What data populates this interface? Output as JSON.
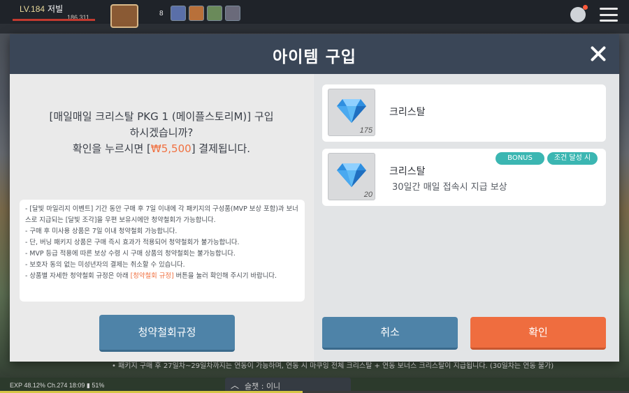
{
  "hud": {
    "level": "LV.184",
    "player_name": "저빌",
    "hp_text": "186,311",
    "quick_count": "8",
    "status": "EXP  48.12%  Ch.274  18:09",
    "battery": "51%",
    "chat_label": "슬챗 : 이니",
    "notice": "• 패키지 구매 후 27일차~29일차까지는 연동이 가능하며, 연동 시 마쿠잉 전체 크리스탈 + 연동 보너스 크리스탈이 지급됩니다. (30일차는 연동 불가)"
  },
  "modal": {
    "title": "아이템 구입",
    "confirm_line1": "[매일매일 크리스탈 PKG 1 (메이플스토리M)] 구입",
    "confirm_line2": "하시겠습니까?",
    "confirm_line3_before": "확인을 누르시면 [",
    "price": "₩5,500",
    "confirm_line3_after": "] 결제됩니다.",
    "terms": {
      "line1": "- [달빛 마일리지 이벤트] 기간 동안 구매 후 7일 이내에 각 패키지의 구성품(MVP 보상 포함)과 보너스로 지급되는 [달빛 조각]을 우편 보유시에만 청약철회가 가능합니다.",
      "line2": "- 구매 후 미사용 상품은 7일 이내 청약철회 가능합니다.",
      "line3": "- 단, 버닝 패키지 상품은 구매 즉시 효과가 적용되어 청약철회가 불가능합니다.",
      "line4": "- MVP 등급 적용에 따른 보상 수령 시 구매 상품의 청약철회는 불가능합니다.",
      "line5": "- 보호자 동의 없는 미성년자의 결제는 취소할 수 있습니다.",
      "line6_before": "- 상품별 자세한 청약철회 규정은 아래 ",
      "line6_link": "[청약철회 규정]",
      "line6_after": " 버튼을 눌러 확인해 주시기 바랍니다."
    },
    "buttons": {
      "policy": "청약철회규정",
      "cancel": "취소",
      "confirm": "확인"
    },
    "items": [
      {
        "name": "크리스탈",
        "qty": "175",
        "desc": ""
      },
      {
        "name": "크리스탈",
        "qty": "20",
        "desc": "30일간 매일 접속시 지급 보상",
        "badges": [
          "BONUS",
          "조건 달성 시"
        ]
      }
    ]
  },
  "colors": {
    "header": "#3a4657",
    "accent_orange": "#ef6d3f",
    "button_blue": "#4e83a8",
    "badge_teal": "#3bb6b2",
    "price": "#f07040"
  },
  "icons": [
    "crystal-icon",
    "close-icon",
    "menu-icon",
    "bag-icon"
  ]
}
